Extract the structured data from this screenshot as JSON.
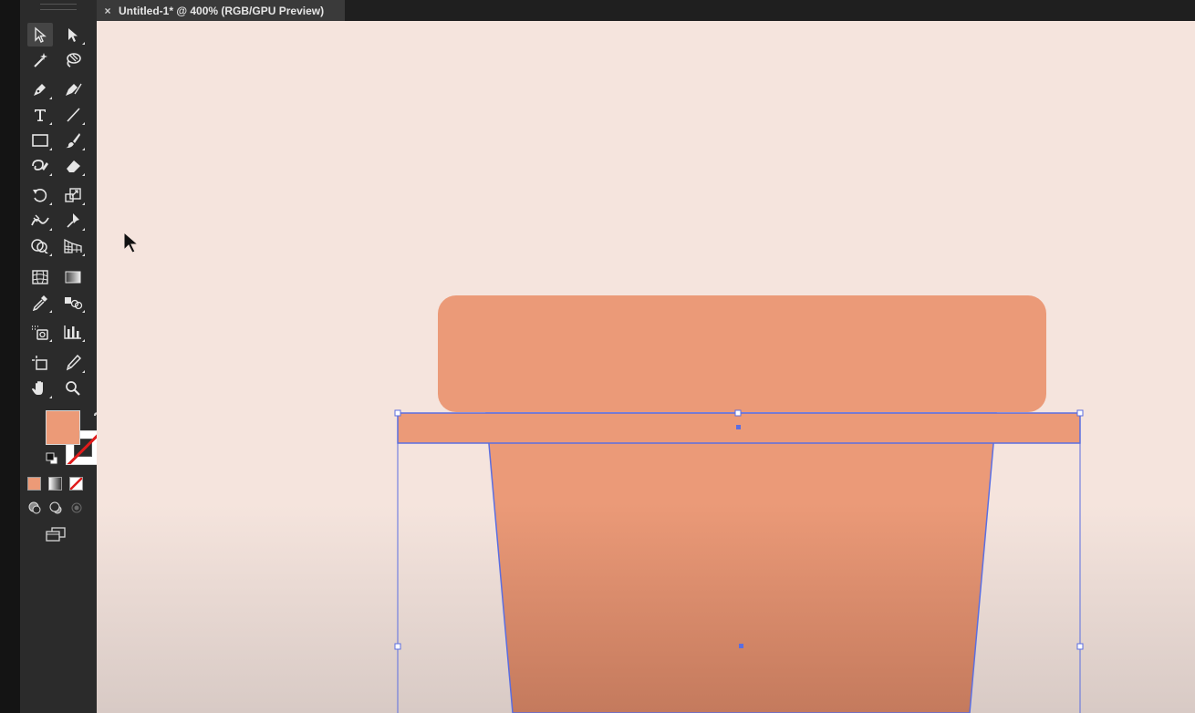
{
  "document_tab": {
    "close_symbol": "×",
    "title": "Untitled-1* @ 400% (RGB/GPU Preview)"
  },
  "colors": {
    "fill": "#ec9a77",
    "canvas_background": "#f5e4dd",
    "selection_blue": "#5b6ee1",
    "pot_rim": "#eb9a78",
    "pot_band": "#eb9a78",
    "pot_body_top": "#eb9a78",
    "pot_body_bottom": "#c47a5d"
  },
  "tools": [
    {
      "name": "selection-tool-icon",
      "active": true
    },
    {
      "name": "direct-selection-tool-icon"
    },
    {
      "name": "magic-wand-tool-icon"
    },
    {
      "name": "lasso-tool-icon"
    },
    {
      "name": "pen-tool-icon"
    },
    {
      "name": "curvature-tool-icon"
    },
    {
      "name": "type-tool-icon"
    },
    {
      "name": "line-segment-tool-icon"
    },
    {
      "name": "rectangle-tool-icon"
    },
    {
      "name": "paintbrush-tool-icon"
    },
    {
      "name": "shaper-tool-icon"
    },
    {
      "name": "eraser-tool-icon"
    },
    {
      "name": "rotate-tool-icon"
    },
    {
      "name": "scale-tool-icon"
    },
    {
      "name": "width-tool-icon"
    },
    {
      "name": "puppet-warp-tool-icon"
    },
    {
      "name": "shape-builder-tool-icon"
    },
    {
      "name": "perspective-grid-tool-icon"
    },
    {
      "name": "mesh-tool-icon"
    },
    {
      "name": "gradient-tool-icon"
    },
    {
      "name": "eyedropper-tool-icon"
    },
    {
      "name": "blend-tool-icon"
    },
    {
      "name": "symbol-sprayer-tool-icon"
    },
    {
      "name": "column-graph-tool-icon"
    },
    {
      "name": "artboard-tool-icon"
    },
    {
      "name": "slice-tool-icon"
    },
    {
      "name": "hand-tool-icon"
    },
    {
      "name": "zoom-tool-icon"
    }
  ]
}
